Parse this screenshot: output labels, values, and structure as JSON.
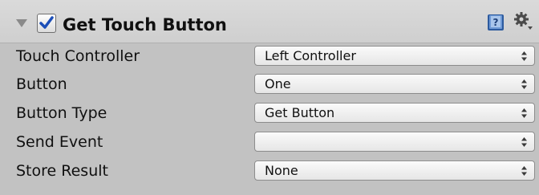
{
  "header": {
    "title": "Get Touch Button",
    "enabled": true,
    "icons": [
      "foldout-arrow-icon",
      "checkbox",
      "help-book-icon",
      "gear-menu-icon"
    ]
  },
  "fields": [
    {
      "label": "Touch Controller",
      "value": "Left Controller"
    },
    {
      "label": "Button",
      "value": "One"
    },
    {
      "label": "Button Type",
      "value": "Get Button"
    },
    {
      "label": "Send Event",
      "value": ""
    },
    {
      "label": "Store Result",
      "value": "None"
    }
  ],
  "colors": {
    "background": "#c2c2c2",
    "checkmark": "#1c4fb8",
    "help_icon": "#3e6fb8"
  }
}
